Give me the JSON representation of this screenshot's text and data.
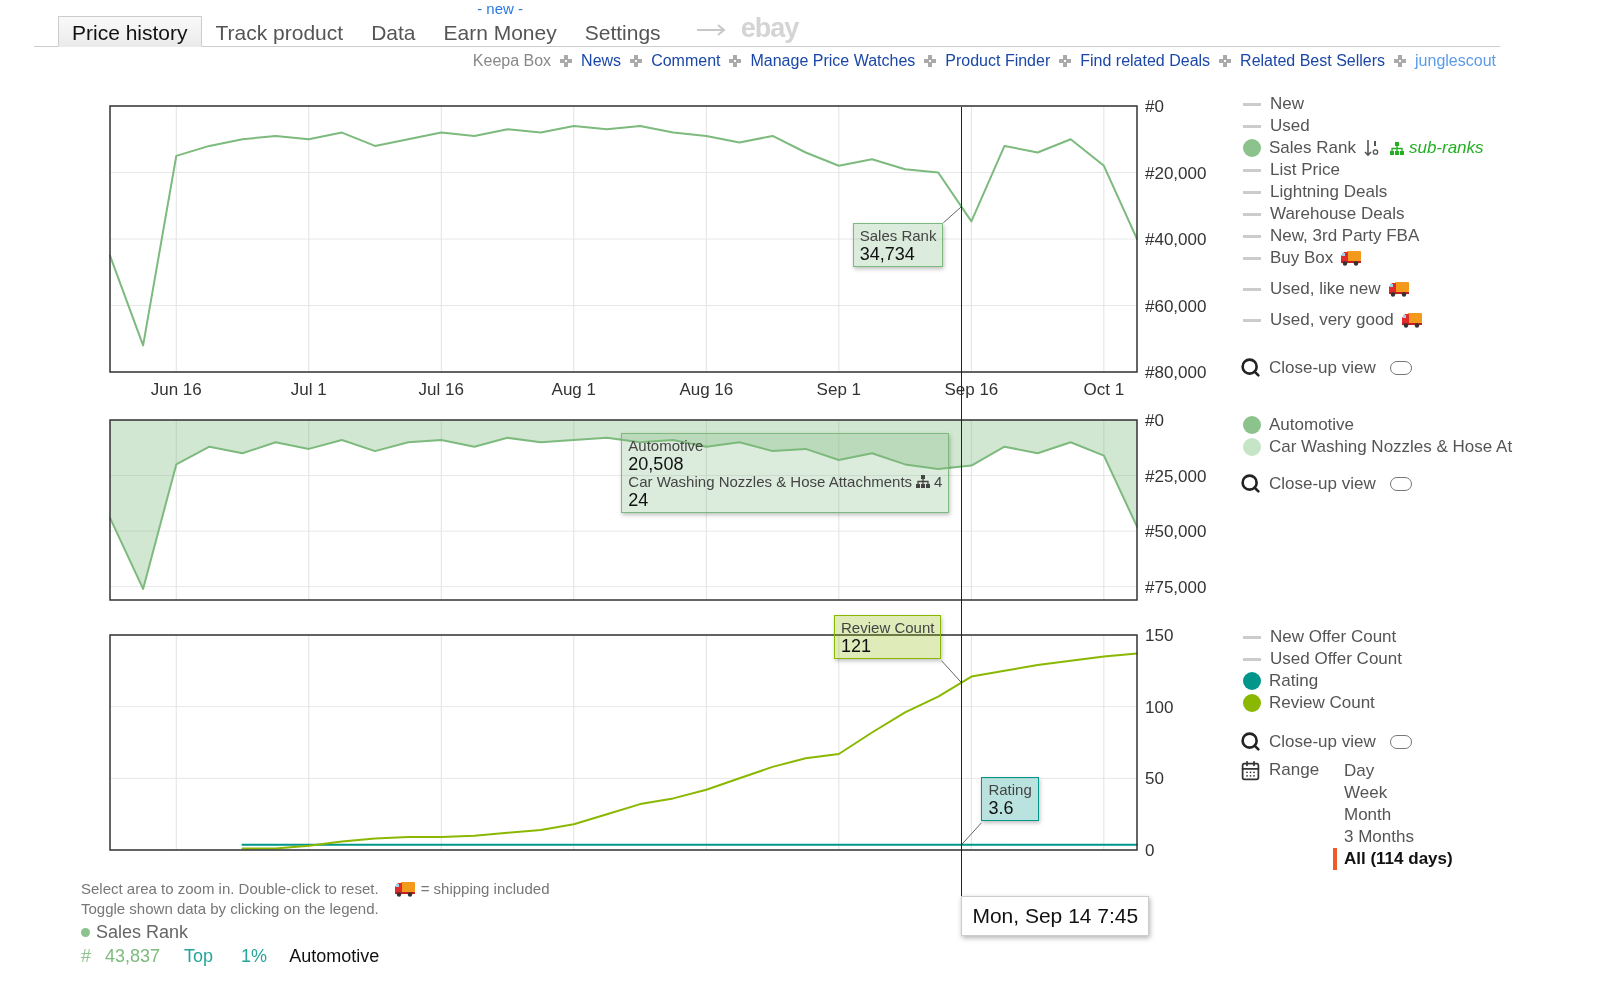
{
  "tabs": [
    {
      "label": "Price history",
      "selected": true
    },
    {
      "label": "Track product",
      "selected": false
    },
    {
      "label": "Data",
      "selected": false
    },
    {
      "label": "Earn Money",
      "selected": false,
      "badge": "- new -"
    },
    {
      "label": "Settings",
      "selected": false
    }
  ],
  "partner": {
    "label": "ebay"
  },
  "links": [
    {
      "label": "Keepa Box",
      "kind": "muted"
    },
    {
      "label": "News",
      "kind": "link"
    },
    {
      "label": "Comment",
      "kind": "link"
    },
    {
      "label": "Manage Price Watches",
      "kind": "link"
    },
    {
      "label": "Product Finder",
      "kind": "link"
    },
    {
      "label": "Find related Deals",
      "kind": "link"
    },
    {
      "label": "Related Best Sellers",
      "kind": "link"
    },
    {
      "label": "junglescout",
      "kind": "external"
    }
  ],
  "panels": [
    {
      "chart_data": {
        "type": "line",
        "categories": [
          null,
          null,
          "Jun 16",
          null,
          null,
          null,
          "Jul 1",
          null,
          null,
          null,
          "Jul 16",
          null,
          null,
          null,
          "Aug 1",
          null,
          null,
          null,
          "Aug 16",
          null,
          null,
          null,
          "Sep 1",
          null,
          null,
          null,
          "Sep 16",
          null,
          null,
          null,
          "Oct 1",
          null
        ],
        "ylim": [
          80000,
          0
        ],
        "series": [
          {
            "name": "Sales Rank",
            "color": "#7dba7d",
            "values": [
              45000,
              72000,
              15000,
              12000,
              10000,
              9000,
              10000,
              8000,
              12000,
              10000,
              8000,
              9000,
              7000,
              8000,
              6000,
              7000,
              6000,
              8000,
              9000,
              11000,
              9000,
              14000,
              18000,
              16000,
              19000,
              20000,
              34700,
              12000,
              14000,
              10000,
              18000,
              40000
            ]
          }
        ],
        "yticks": [
          {
            "value": 0,
            "label": "#0"
          },
          {
            "value": 20000,
            "label": "#20,000"
          },
          {
            "value": 40000,
            "label": "#40,000"
          },
          {
            "value": 60000,
            "label": "#60,000"
          },
          {
            "value": 80000,
            "label": "#80,000"
          }
        ],
        "grid": true,
        "annotations": [
          "34,734"
        ]
      },
      "legend": [
        {
          "label": "New",
          "kind": "line"
        },
        {
          "label": "Used",
          "kind": "line"
        },
        {
          "label": "Sales Rank",
          "kind": "dot",
          "color": "#8cc28c",
          "sort_icon": true,
          "sublink": "sub-ranks"
        },
        {
          "label": "List Price",
          "kind": "line"
        },
        {
          "label": "Lightning Deals",
          "kind": "line"
        },
        {
          "label": "Warehouse Deals",
          "kind": "line"
        },
        {
          "label": "New, 3rd Party FBA",
          "kind": "line"
        },
        {
          "label": "Buy Box",
          "kind": "line",
          "shipping": true
        },
        {
          "label": "Used, like new",
          "kind": "line",
          "shipping": true
        },
        {
          "label": "Used, very good",
          "kind": "line",
          "shipping": true
        }
      ],
      "closeup": {
        "label": "Close-up view",
        "on": false
      }
    },
    {
      "chart_data": {
        "type": "area",
        "categories": [
          null,
          null,
          null,
          null,
          null,
          null,
          null,
          null,
          null,
          null,
          null,
          null,
          null,
          null,
          null,
          null,
          null,
          null,
          null,
          null,
          null,
          null,
          null,
          null,
          null,
          null,
          null,
          null,
          null,
          null,
          null,
          null
        ],
        "ylim": [
          81000,
          0
        ],
        "series": [
          {
            "name": "Automotive",
            "color": "#7dba7d",
            "values": [
              44000,
              76000,
              20000,
              12000,
              15000,
              10000,
              13000,
              9000,
              14000,
              10000,
              9000,
              12000,
              8000,
              10000,
              9000,
              8000,
              10000,
              9000,
              12000,
              10000,
              14000,
              13000,
              18000,
              15000,
              20000,
              22000,
              20500,
              12000,
              15000,
              10000,
              16000,
              48000
            ]
          }
        ],
        "yticks": [
          {
            "value": 0,
            "label": "#0"
          },
          {
            "value": 25000,
            "label": "#25,000"
          },
          {
            "value": 50000,
            "label": "#50,000"
          },
          {
            "value": 75000,
            "label": "#75,000"
          }
        ],
        "grid": true,
        "annotations": [
          "20,508"
        ]
      },
      "tooltip_rows": [
        {
          "text": "Car Washing Nozzles & Hose Attachments",
          "count": "4"
        },
        {
          "text": "24"
        }
      ],
      "legend": [
        {
          "label": "Automotive",
          "kind": "dot",
          "color": "#8cc28c"
        },
        {
          "label": "Car Washing Nozzles & Hose At",
          "kind": "dot",
          "color": "#c6e4c6"
        }
      ],
      "closeup": {
        "label": "Close-up view",
        "on": false
      }
    },
    {
      "chart_data": {
        "type": "line",
        "categories": [
          null,
          null,
          null,
          null,
          null,
          null,
          null,
          null,
          null,
          null,
          null,
          null,
          null,
          null,
          null,
          null,
          null,
          null,
          null,
          null,
          null,
          null,
          null,
          null,
          null,
          null,
          null,
          null,
          null,
          null,
          null,
          null
        ],
        "ylim": [
          0,
          150
        ],
        "series": [
          {
            "name": "Rating",
            "color": "#00968a",
            "values": [
              null,
              null,
              null,
              null,
              3.6,
              3.6,
              3.6,
              3.6,
              3.6,
              3.6,
              3.6,
              3.6,
              3.6,
              3.6,
              3.6,
              3.6,
              3.6,
              3.6,
              3.6,
              3.6,
              3.6,
              3.6,
              3.6,
              3.6,
              3.6,
              3.6,
              3.6,
              3.6,
              3.6,
              3.6,
              3.6,
              3.6
            ]
          },
          {
            "name": "Review Count",
            "color": "#8ab800",
            "values": [
              null,
              null,
              null,
              null,
              1,
              1,
              3,
              6,
              8,
              9,
              9,
              10,
              12,
              14,
              18,
              25,
              32,
              36,
              42,
              50,
              58,
              64,
              67,
              82,
              96,
              107,
              121,
              125,
              129,
              132,
              135,
              137
            ]
          }
        ],
        "yticks": [
          {
            "value": 0,
            "label": "0"
          },
          {
            "value": 50,
            "label": "50"
          },
          {
            "value": 100,
            "label": "100"
          },
          {
            "value": 150,
            "label": "150"
          }
        ],
        "grid": true,
        "annotations": [
          "3.6",
          "121"
        ]
      },
      "legend": [
        {
          "label": "New Offer Count",
          "kind": "line"
        },
        {
          "label": "Used Offer Count",
          "kind": "line"
        },
        {
          "label": "Rating",
          "kind": "dot",
          "color": "#00968a"
        },
        {
          "label": "Review Count",
          "kind": "dot",
          "color": "#8ab800"
        }
      ],
      "closeup": {
        "label": "Close-up view",
        "on": false
      },
      "range": {
        "label": "Range",
        "options": [
          {
            "label": "Day",
            "selected": false
          },
          {
            "label": "Week",
            "selected": false
          },
          {
            "label": "Month",
            "selected": false
          },
          {
            "label": "3 Months",
            "selected": false
          },
          {
            "label": "All (114 days)",
            "selected": true
          }
        ]
      }
    }
  ],
  "crosshair_date": "Mon, Sep 14 7:45",
  "footer": {
    "hint": "Select area to zoom in. Double-click to reset.",
    "shipping_note": "= shipping included",
    "hint2": "Toggle shown data by clicking on the legend.",
    "summary": {
      "label": "Sales Rank",
      "color": "#8cc28c",
      "hash": "#",
      "rank": "43,837",
      "top": "Top",
      "percent": "1%",
      "category": "Automotive"
    }
  }
}
